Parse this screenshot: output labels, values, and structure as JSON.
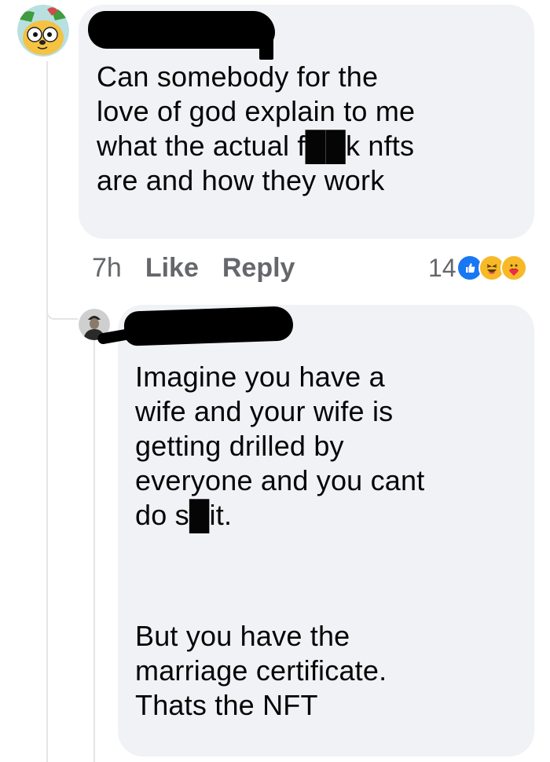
{
  "comment": {
    "text": "Can somebody for the\nlove of god explain to me\nwhat the actual f██k nfts\nare and how they work",
    "timestamp": "7h",
    "like_label": "Like",
    "reply_label": "Reply",
    "reaction_count": "14",
    "reactions": [
      "like-icon",
      "haha-icon",
      "care-icon"
    ]
  },
  "reply": {
    "text_part1": "Imagine you have a\nwife and your wife is\ngetting drilled by\neveryone and you cant\ndo s█it.",
    "text_part2": "But you have the\nmarriage certificate.\nThats the NFT"
  },
  "colors": {
    "bubble": "#f0f2f5",
    "text": "#050505",
    "meta": "#65676b",
    "like_blue": "#1877f2",
    "haha_yellow": "#f7b928"
  }
}
